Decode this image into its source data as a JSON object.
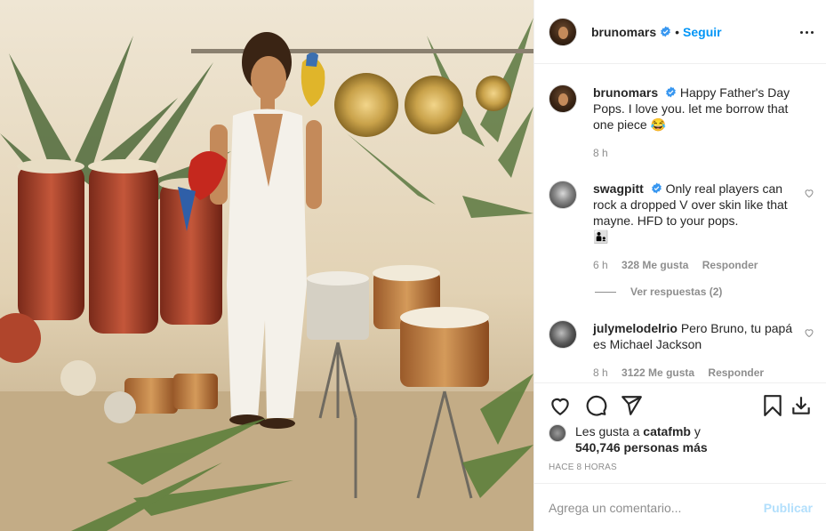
{
  "post": {
    "author": "brunomars",
    "follow_label": "Seguir",
    "separator": "•",
    "caption_text": "Happy Father's Day Pops. I love you. let me borrow that one piece 😂",
    "caption_time": "8 h"
  },
  "comments": [
    {
      "user": "swagpitt",
      "text": "Only real players can rock a dropped V over skin like that mayne. HFD to your pops.",
      "emoji": "👨‍👦",
      "time": "6 h",
      "likes": "328 Me gusta",
      "reply_label": "Responder",
      "view_replies": "Ver respuestas (2)"
    },
    {
      "user": "julymelodelrio",
      "text": "Pero Bruno, tu papá es Michael Jackson",
      "time": "8 h",
      "likes": "3122 Me gusta",
      "reply_label": "Responder"
    }
  ],
  "likes": {
    "prefix": "Les gusta a",
    "user": "catafmb",
    "conjunction": "y",
    "count": "540,746 personas más"
  },
  "timestamp": "HACE 8 HORAS",
  "add_comment": {
    "placeholder": "Agrega un comentario...",
    "publish_label": "Publicar"
  },
  "colors": {
    "link_blue": "#0095f6",
    "publish_disabled": "#b2dffc",
    "muted": "#8e8e8e",
    "text": "#262626",
    "border": "#efefef"
  },
  "icons": [
    "verified-badge-icon",
    "more-options-icon",
    "heart-icon",
    "comment-icon",
    "share-icon",
    "bookmark-icon",
    "download-icon"
  ]
}
